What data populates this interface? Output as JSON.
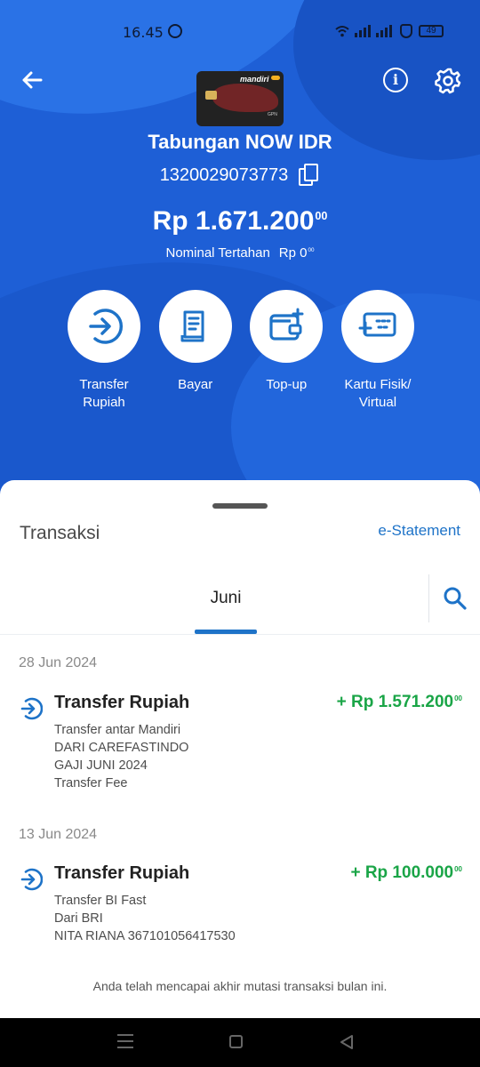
{
  "status_bar": {
    "time": "16.45",
    "battery": "49"
  },
  "account": {
    "card_brand": "mandiri",
    "card_network": "GPN",
    "name": "Tabungan NOW IDR",
    "number": "1320029073773",
    "balance_main": "Rp 1.671.200",
    "balance_cents": "00",
    "held_label": "Nominal Tertahan",
    "held_main": "Rp 0",
    "held_cents": "00"
  },
  "actions": [
    {
      "label": "Transfer\nRupiah",
      "icon": "transfer-arrow-icon"
    },
    {
      "label": "Bayar",
      "icon": "receipt-icon"
    },
    {
      "label": "Top-up",
      "icon": "wallet-plus-icon"
    },
    {
      "label": "Kartu Fisik/\nVirtual",
      "icon": "card-plus-icon"
    }
  ],
  "transactions_panel": {
    "title": "Transaksi",
    "estatement_label": "e-Statement",
    "active_month": "Juni",
    "groups": [
      {
        "date": "28 Jun 2024",
        "items": [
          {
            "title": "Transfer Rupiah",
            "amount_main": "+ Rp 1.571.200",
            "amount_cents": "00",
            "details": [
              "Transfer antar Mandiri",
              "DARI CAREFASTINDO",
              "GAJI JUNI 2024",
              "Transfer Fee"
            ]
          }
        ]
      },
      {
        "date": "13 Jun 2024",
        "items": [
          {
            "title": "Transfer Rupiah",
            "amount_main": "+ Rp 100.000",
            "amount_cents": "00",
            "details": [
              "Transfer BI Fast",
              "Dari BRI",
              "NITA RIANA 367101056417530"
            ]
          }
        ]
      }
    ],
    "end_note": "Anda telah mencapai akhir mutasi transaksi bulan ini."
  },
  "colors": {
    "primary_blue": "#1e5fd6",
    "link_blue": "#1e73c8",
    "credit_green": "#1aa547"
  }
}
